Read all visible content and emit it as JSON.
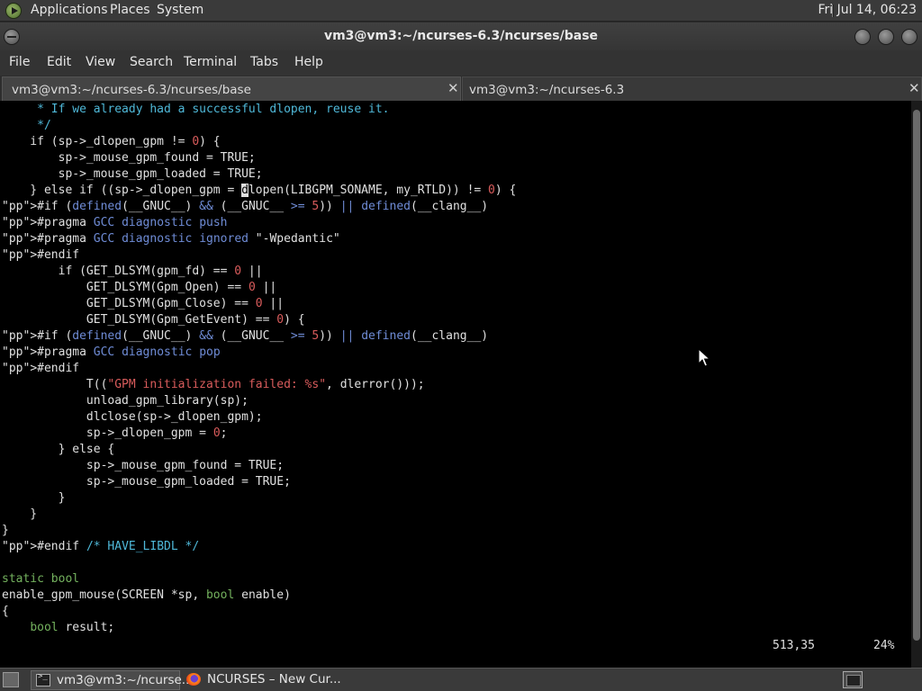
{
  "top_panel": {
    "applications": "Applications",
    "places": "Places",
    "system": "System",
    "clock": "Fri Jul 14, 06:23"
  },
  "window": {
    "title": "vm3@vm3:~/ncurses-6.3/ncurses/base"
  },
  "menubar": {
    "file": "File",
    "edit": "Edit",
    "view": "View",
    "search": "Search",
    "terminal": "Terminal",
    "tabs": "Tabs",
    "help": "Help"
  },
  "tabs": [
    {
      "label": "vm3@vm3:~/ncurses-6.3/ncurses/base",
      "close": "✕"
    },
    {
      "label": "vm3@vm3:~/ncurses-6.3",
      "close": "✕"
    }
  ],
  "code_lines": [
    "     * If we already had a successful dlopen, reuse it.",
    "     */",
    "    if (sp->_dlopen_gpm != 0) {",
    "        sp->_mouse_gpm_found = TRUE;",
    "        sp->_mouse_gpm_loaded = TRUE;",
    "    } else if ((sp->_dlopen_gpm = dlopen(LIBGPM_SONAME, my_RTLD)) != 0) {",
    "#if (defined(__GNUC__) && (__GNUC__ >= 5)) || defined(__clang__)",
    "#pragma GCC diagnostic push",
    "#pragma GCC diagnostic ignored \"-Wpedantic\"",
    "#endif",
    "        if (GET_DLSYM(gpm_fd) == 0 ||",
    "            GET_DLSYM(Gpm_Open) == 0 ||",
    "            GET_DLSYM(Gpm_Close) == 0 ||",
    "            GET_DLSYM(Gpm_GetEvent) == 0) {",
    "#if (defined(__GNUC__) && (__GNUC__ >= 5)) || defined(__clang__)",
    "#pragma GCC diagnostic pop",
    "#endif",
    "            T((\"GPM initialization failed: %s\", dlerror()));",
    "            unload_gpm_library(sp);",
    "            dlclose(sp->_dlopen_gpm);",
    "            sp->_dlopen_gpm = 0;",
    "        } else {",
    "            sp->_mouse_gpm_found = TRUE;",
    "            sp->_mouse_gpm_loaded = TRUE;",
    "        }",
    "    }",
    "}",
    "#endif /* HAVE_LIBDL */",
    "",
    "static bool",
    "enable_gpm_mouse(SCREEN *sp, bool enable)",
    "{",
    "    bool result;"
  ],
  "status": {
    "position": "513,35",
    "percent": "24%"
  },
  "taskbar": {
    "terminal_task": "vm3@vm3:~/ncurse...",
    "firefox_task": "NCURSES – New Cur..."
  }
}
